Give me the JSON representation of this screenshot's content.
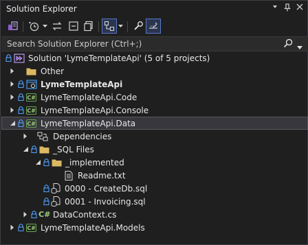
{
  "window": {
    "title": "Solution Explorer",
    "controls": [
      "dropdown-icon",
      "pin-icon",
      "close-icon"
    ]
  },
  "toolbar": {
    "buttons": [
      "switch-views-icon",
      "pending-changes-filter-icon",
      "sync-with-active-document-icon",
      "collapse-all-icon",
      "show-all-files-icon",
      "preview-selected-items-icon",
      "properties-icon",
      "toggle-view-icon"
    ]
  },
  "search": {
    "placeholder": "Search Solution Explorer (Ctrl+;)"
  },
  "tree": {
    "solution": "Solution 'LymeTemplateApi' (5 of 5 projects)",
    "items": [
      {
        "label": "Other"
      },
      {
        "label": "LymeTemplateApi"
      },
      {
        "label": "LymeTemplateApi.Code"
      },
      {
        "label": "LymeTemplateApi.Console"
      },
      {
        "label": "LymeTemplateApi.Data"
      },
      {
        "label": "Dependencies"
      },
      {
        "label": "_SQL Files"
      },
      {
        "label": "_implemented"
      },
      {
        "label": "Readme.txt"
      },
      {
        "label": "0000 - CreateDb.sql"
      },
      {
        "label": "0001 - Invoicing.sql"
      },
      {
        "label": "DataContext.cs"
      },
      {
        "label": "LymeTemplateApi.Models"
      }
    ]
  },
  "colors": {
    "background": "#1f1f1f",
    "selection": "#37373d",
    "lock_blue": "#4ea1ff",
    "csharp_green": "#6aa84f",
    "folder": "#dcb862"
  }
}
